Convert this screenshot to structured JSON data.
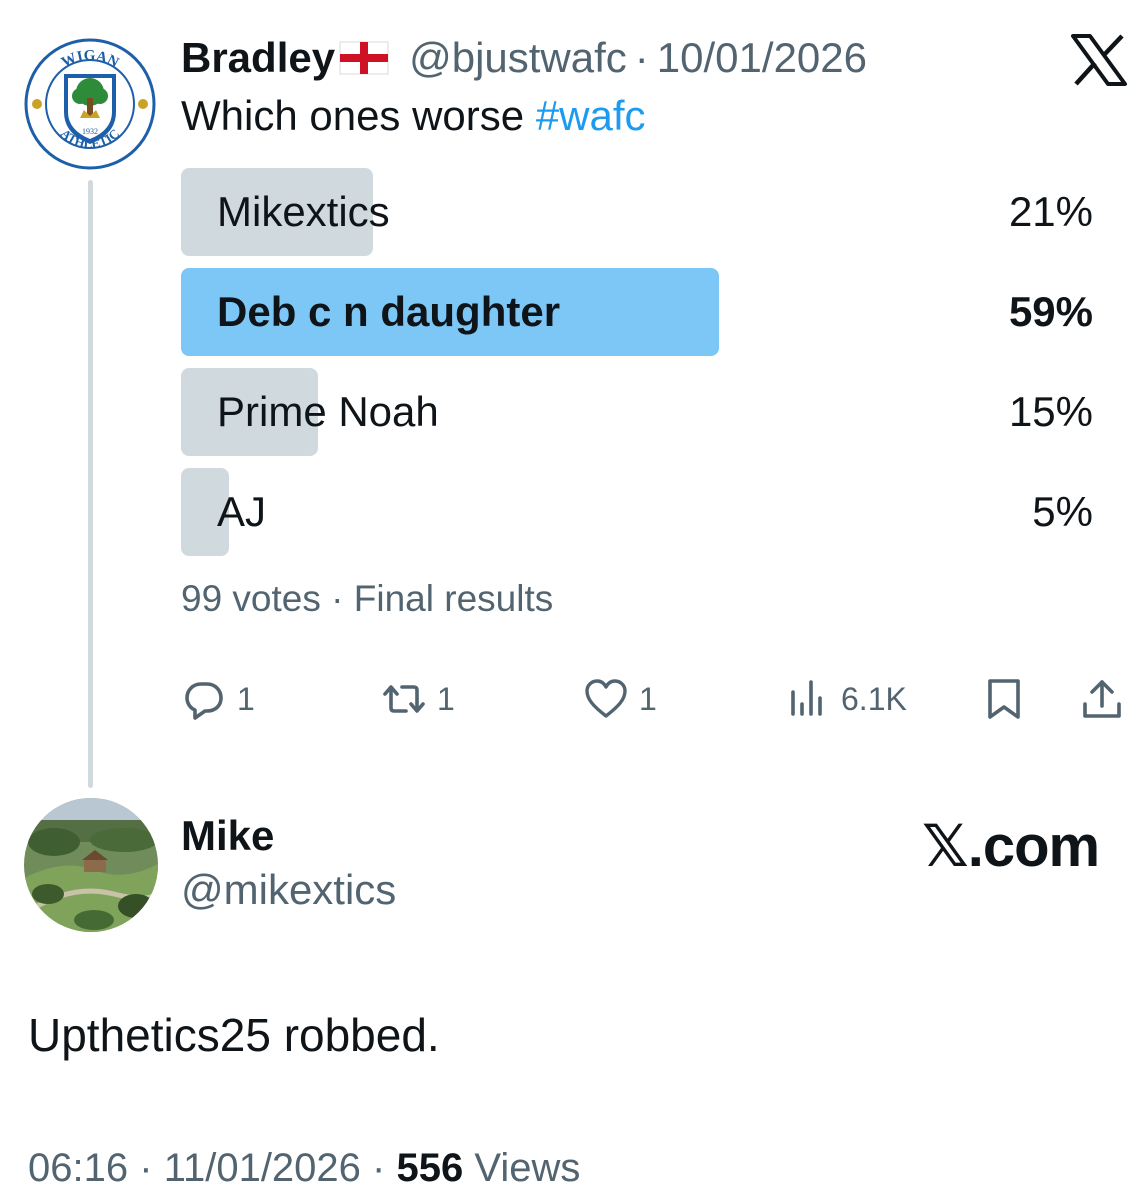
{
  "tweet": {
    "author_name": "Bradley",
    "author_flag_icon": "england-flag-icon",
    "author_handle": "@bjustwafc",
    "separator": "·",
    "date": "10/01/2026",
    "text": "Which ones worse ",
    "hashtag": "#wafc",
    "avatar_icon": "wigan-athletic-crest",
    "avatar_text": {
      "top": "WIGAN",
      "bottom": "ATHLETIC",
      "year": "1932"
    }
  },
  "poll": {
    "options": [
      {
        "label": "Mikextics",
        "percent": "21%",
        "value": 21,
        "winner": false
      },
      {
        "label": "Deb c n daughter",
        "percent": "59%",
        "value": 59,
        "winner": true
      },
      {
        "label": "Prime Noah",
        "percent": "15%",
        "value": 15,
        "winner": false
      },
      {
        "label": "AJ",
        "percent": "5%",
        "value": 5,
        "winner": false
      }
    ],
    "votes": "99 votes",
    "separator": "·",
    "status": "Final results"
  },
  "actions": {
    "reply": {
      "icon": "reply-icon",
      "count": "1"
    },
    "retweet": {
      "icon": "retweet-icon",
      "count": "1"
    },
    "like": {
      "icon": "heart-icon",
      "count": "1"
    },
    "views": {
      "icon": "views-icon",
      "count": "6.1K"
    },
    "bookmark": {
      "icon": "bookmark-icon"
    },
    "share": {
      "icon": "share-icon"
    }
  },
  "reply_author": {
    "name": "Mike",
    "handle": "@mikextics",
    "avatar_icon": "park-photo-avatar"
  },
  "brand": {
    "text": "𝕏.com",
    "top_logo": "x-logo-icon"
  },
  "reply": {
    "text": "Upthetics25 robbed.",
    "time": "06:16",
    "date": "11/01/2026",
    "separator": "·",
    "views_count": "556",
    "views_label": " Views"
  },
  "colors": {
    "text_primary": "#0f1419",
    "text_secondary": "#536471",
    "link": "#1d9bf0",
    "poll_bar": "#cfd9de",
    "poll_winner": "#7dc7f7",
    "thread_line": "#cfd9de"
  }
}
